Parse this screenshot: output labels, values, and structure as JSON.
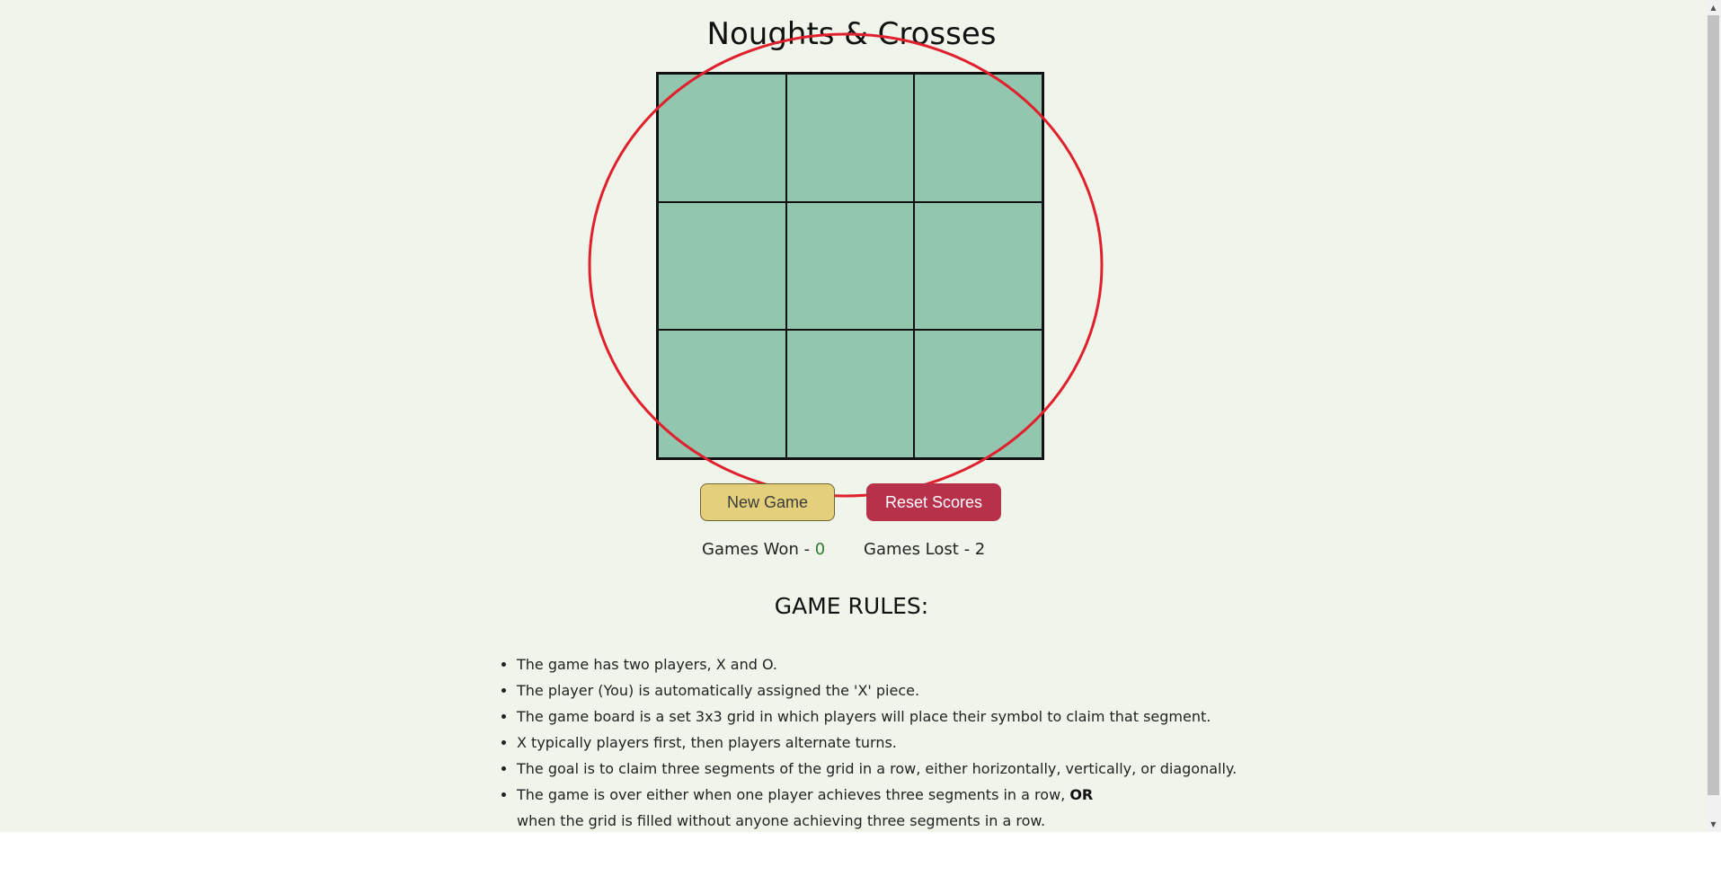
{
  "page": {
    "title": "Noughts & Crosses"
  },
  "board": {
    "cells": [
      "",
      "",
      "",
      "",
      "",
      "",
      "",
      "",
      ""
    ]
  },
  "controls": {
    "new_game_label": "New Game",
    "reset_scores_label": "Reset Scores"
  },
  "scores": {
    "won_label": "Games Won - ",
    "won_value": "0",
    "lost_label": "Games Lost - ",
    "lost_value": "2"
  },
  "rules": {
    "heading": "GAME RULES:",
    "items": [
      "The game has two players, X and O.",
      "The player (You) is automatically assigned the 'X' piece.",
      "The game board is a set 3x3 grid in which players will place their symbol to claim that segment.",
      "X typically players first, then players alternate turns.",
      "The goal is to claim three segments of the grid in a row, either horizontally, vertically, or diagonally.",
      "The game is over either when one player achieves three segments in a row, "
    ],
    "last_item_emphasis": "OR",
    "last_item_continuation": "when the grid is filled without anyone achieving three segments in a row."
  },
  "colors": {
    "background": "#f0f5ec",
    "board_cell": "#93c6af",
    "new_game_button": "#e4cf7d",
    "reset_button": "#b8314a",
    "won_value": "#2e7d32",
    "annotation_circle": "#e0202c"
  },
  "icons": {
    "scroll_up": "scroll-up-arrow-icon",
    "scroll_down": "scroll-down-arrow-icon"
  }
}
